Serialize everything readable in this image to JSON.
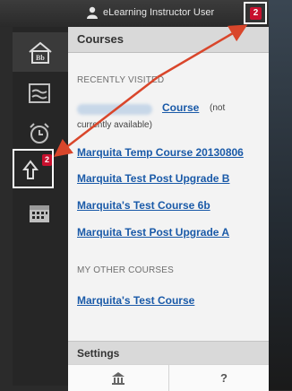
{
  "topbar": {
    "user_name": "eLearning Instructor User",
    "notification_count": "2",
    "user_icon": "user-silhouette-icon"
  },
  "rail": {
    "items": [
      {
        "icon": "blackboard-home-icon",
        "label": "Bb"
      },
      {
        "icon": "stream-icon"
      },
      {
        "icon": "alarm-clock-icon"
      },
      {
        "icon": "updates-icon",
        "badge": "2"
      },
      {
        "icon": "calendar-icon"
      }
    ]
  },
  "panel": {
    "title": "Courses",
    "recent_label": "RECENTLY VISITED",
    "unavailable_course": {
      "name_suffix": "Course",
      "note_line1": "(not",
      "note_line2": "currently available)"
    },
    "recent_courses": [
      "Marquita Temp Course 20130806",
      "Marquita Test Post Upgrade B",
      "Marquita's Test Course 6b",
      "Marquita Test Post Upgrade A"
    ],
    "other_label": "MY OTHER COURSES",
    "other_courses": [
      "Marquita's Test Course"
    ],
    "settings": {
      "title": "Settings",
      "help_label": "?"
    }
  },
  "colors": {
    "link": "#1a5aa8",
    "badge": "#c8102e",
    "annotation_arrow": "#d9462b",
    "rail_bg": "#262626",
    "panel_bg": "#f3f3f3"
  }
}
